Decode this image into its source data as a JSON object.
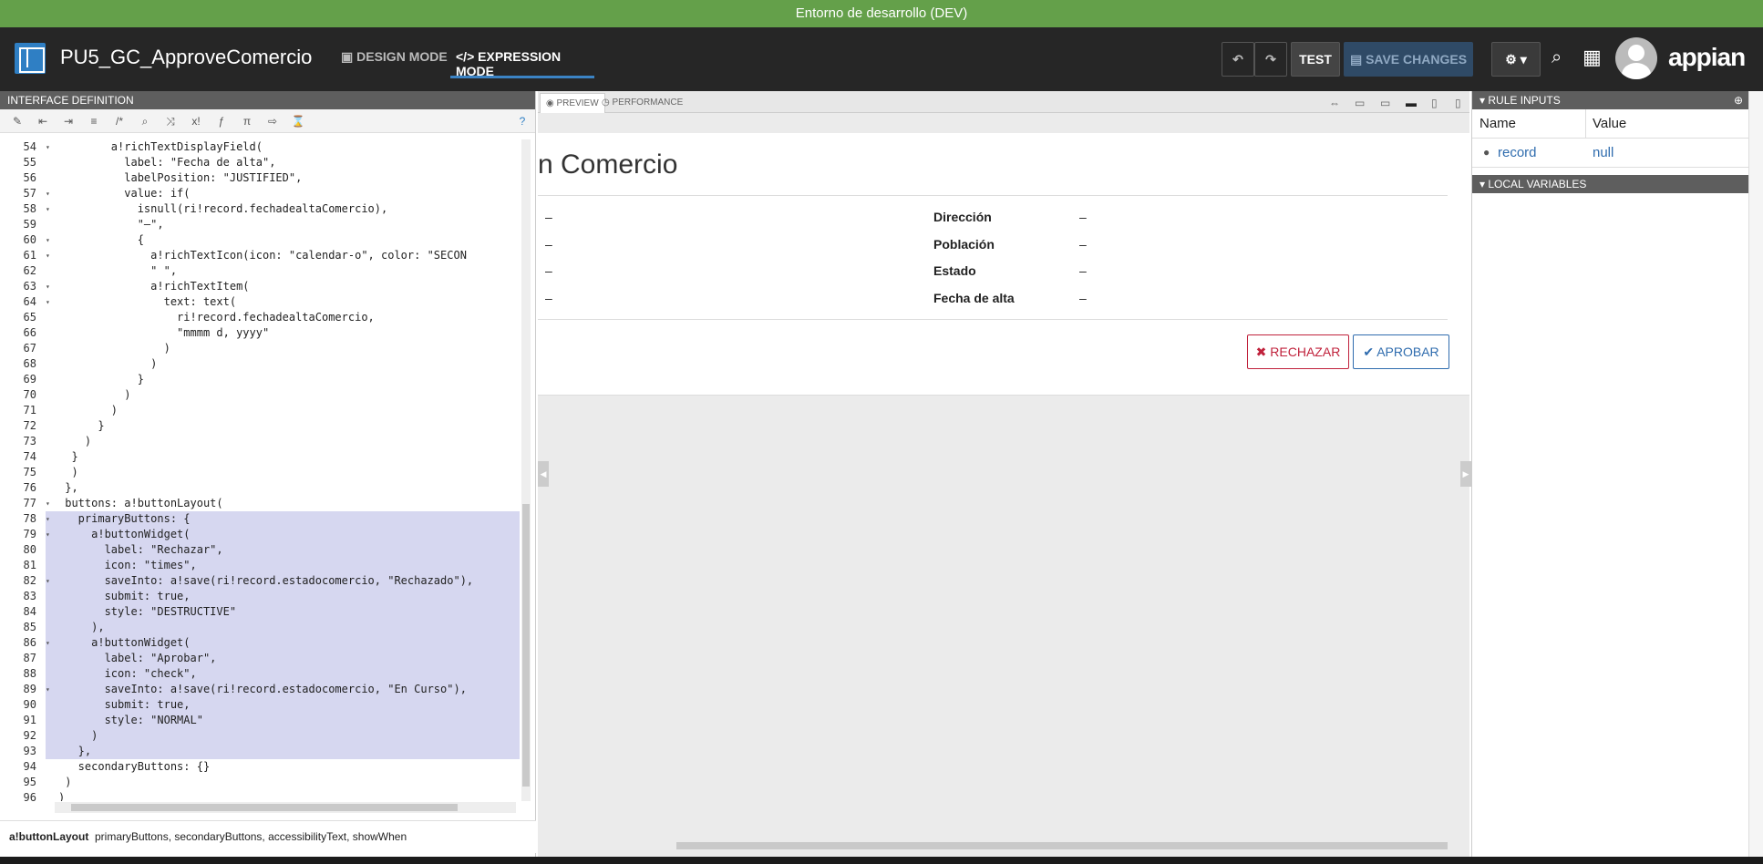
{
  "env_banner": "Entorno de desarrollo (DEV)",
  "header": {
    "app_title": "PU5_GC_ApproveComercio",
    "design_mode": "DESIGN MODE",
    "expression_mode": "EXPRESSION MODE",
    "test": "TEST",
    "save_changes": "SAVE CHANGES",
    "brand": "appian"
  },
  "left_panel": {
    "title": "INTERFACE DEFINITION",
    "hint_fn": "a!buttonLayout",
    "hint_params": "primaryButtons, secondaryButtons, accessibilityText, showWhen",
    "lines": [
      {
        "n": "54",
        "t": "        a!richTextDisplayField(",
        "f": true
      },
      {
        "n": "55",
        "t": "          label: \"Fecha de alta\","
      },
      {
        "n": "56",
        "t": "          labelPosition: \"JUSTIFIED\","
      },
      {
        "n": "57",
        "t": "          value: if(",
        "f": true
      },
      {
        "n": "58",
        "t": "            isnull(ri!record.fechadealtaComercio),",
        "f": true
      },
      {
        "n": "59",
        "t": "            \"–\","
      },
      {
        "n": "60",
        "t": "            {",
        "f": true
      },
      {
        "n": "61",
        "t": "              a!richTextIcon(icon: \"calendar-o\", color: \"SECON",
        "f": true
      },
      {
        "n": "62",
        "t": "              \" \","
      },
      {
        "n": "63",
        "t": "              a!richTextItem(",
        "f": true
      },
      {
        "n": "64",
        "t": "                text: text(",
        "f": true
      },
      {
        "n": "65",
        "t": "                  ri!record.fechadealtaComercio,"
      },
      {
        "n": "66",
        "t": "                  \"mmmm d, yyyy\""
      },
      {
        "n": "67",
        "t": "                )"
      },
      {
        "n": "68",
        "t": "              )"
      },
      {
        "n": "69",
        "t": "            }"
      },
      {
        "n": "70",
        "t": "          )"
      },
      {
        "n": "71",
        "t": "        )"
      },
      {
        "n": "72",
        "t": "      }"
      },
      {
        "n": "73",
        "t": "    )"
      },
      {
        "n": "74",
        "t": "  }"
      },
      {
        "n": "75",
        "t": "  )"
      },
      {
        "n": "76",
        "t": " },"
      },
      {
        "n": "77",
        "t": " buttons: a!buttonLayout(",
        "f": true
      },
      {
        "n": "78",
        "t": "   primaryButtons: {",
        "f": true,
        "s": true
      },
      {
        "n": "79",
        "t": "     a!buttonWidget(",
        "f": true,
        "s": true
      },
      {
        "n": "80",
        "t": "       label: \"Rechazar\",",
        "s": true
      },
      {
        "n": "81",
        "t": "       icon: \"times\",",
        "s": true
      },
      {
        "n": "82",
        "t": "       saveInto: a!save(ri!record.estadocomercio, \"Rechazado\"),",
        "f": true,
        "s": true
      },
      {
        "n": "83",
        "t": "       submit: true,",
        "s": true
      },
      {
        "n": "84",
        "t": "       style: \"DESTRUCTIVE\"",
        "s": true
      },
      {
        "n": "85",
        "t": "     ),",
        "s": true
      },
      {
        "n": "86",
        "t": "     a!buttonWidget(",
        "f": true,
        "s": true
      },
      {
        "n": "87",
        "t": "       label: \"Aprobar\",",
        "s": true
      },
      {
        "n": "88",
        "t": "       icon: \"check\",",
        "s": true
      },
      {
        "n": "89",
        "t": "       saveInto: a!save(ri!record.estadocomercio, \"En Curso\"),",
        "f": true,
        "s": true
      },
      {
        "n": "90",
        "t": "       submit: true,",
        "s": true
      },
      {
        "n": "91",
        "t": "       style: \"NORMAL\"",
        "s": true
      },
      {
        "n": "92",
        "t": "     )",
        "s": true
      },
      {
        "n": "93",
        "t": "   },",
        "s": true
      },
      {
        "n": "94",
        "t": "   secondaryButtons: {}"
      },
      {
        "n": "95",
        "t": " )"
      },
      {
        "n": "96",
        "t": ")"
      }
    ]
  },
  "preview": {
    "tab_preview": "PREVIEW",
    "tab_performance": "PERFORMANCE",
    "title": "n Comercio",
    "left_values": [
      "–",
      "–",
      "–",
      "–"
    ],
    "fields": [
      {
        "label": "Dirección",
        "value": "–"
      },
      {
        "label": "Población",
        "value": "–"
      },
      {
        "label": "Estado",
        "value": "–"
      },
      {
        "label": "Fecha de alta",
        "value": "–"
      }
    ],
    "reject": "RECHAZAR",
    "approve": "APROBAR"
  },
  "right_panel": {
    "rule_inputs": "RULE INPUTS",
    "col_name": "Name",
    "col_value": "Value",
    "input_name": "record",
    "input_value": "null",
    "local_variables": "LOCAL VARIABLES"
  }
}
